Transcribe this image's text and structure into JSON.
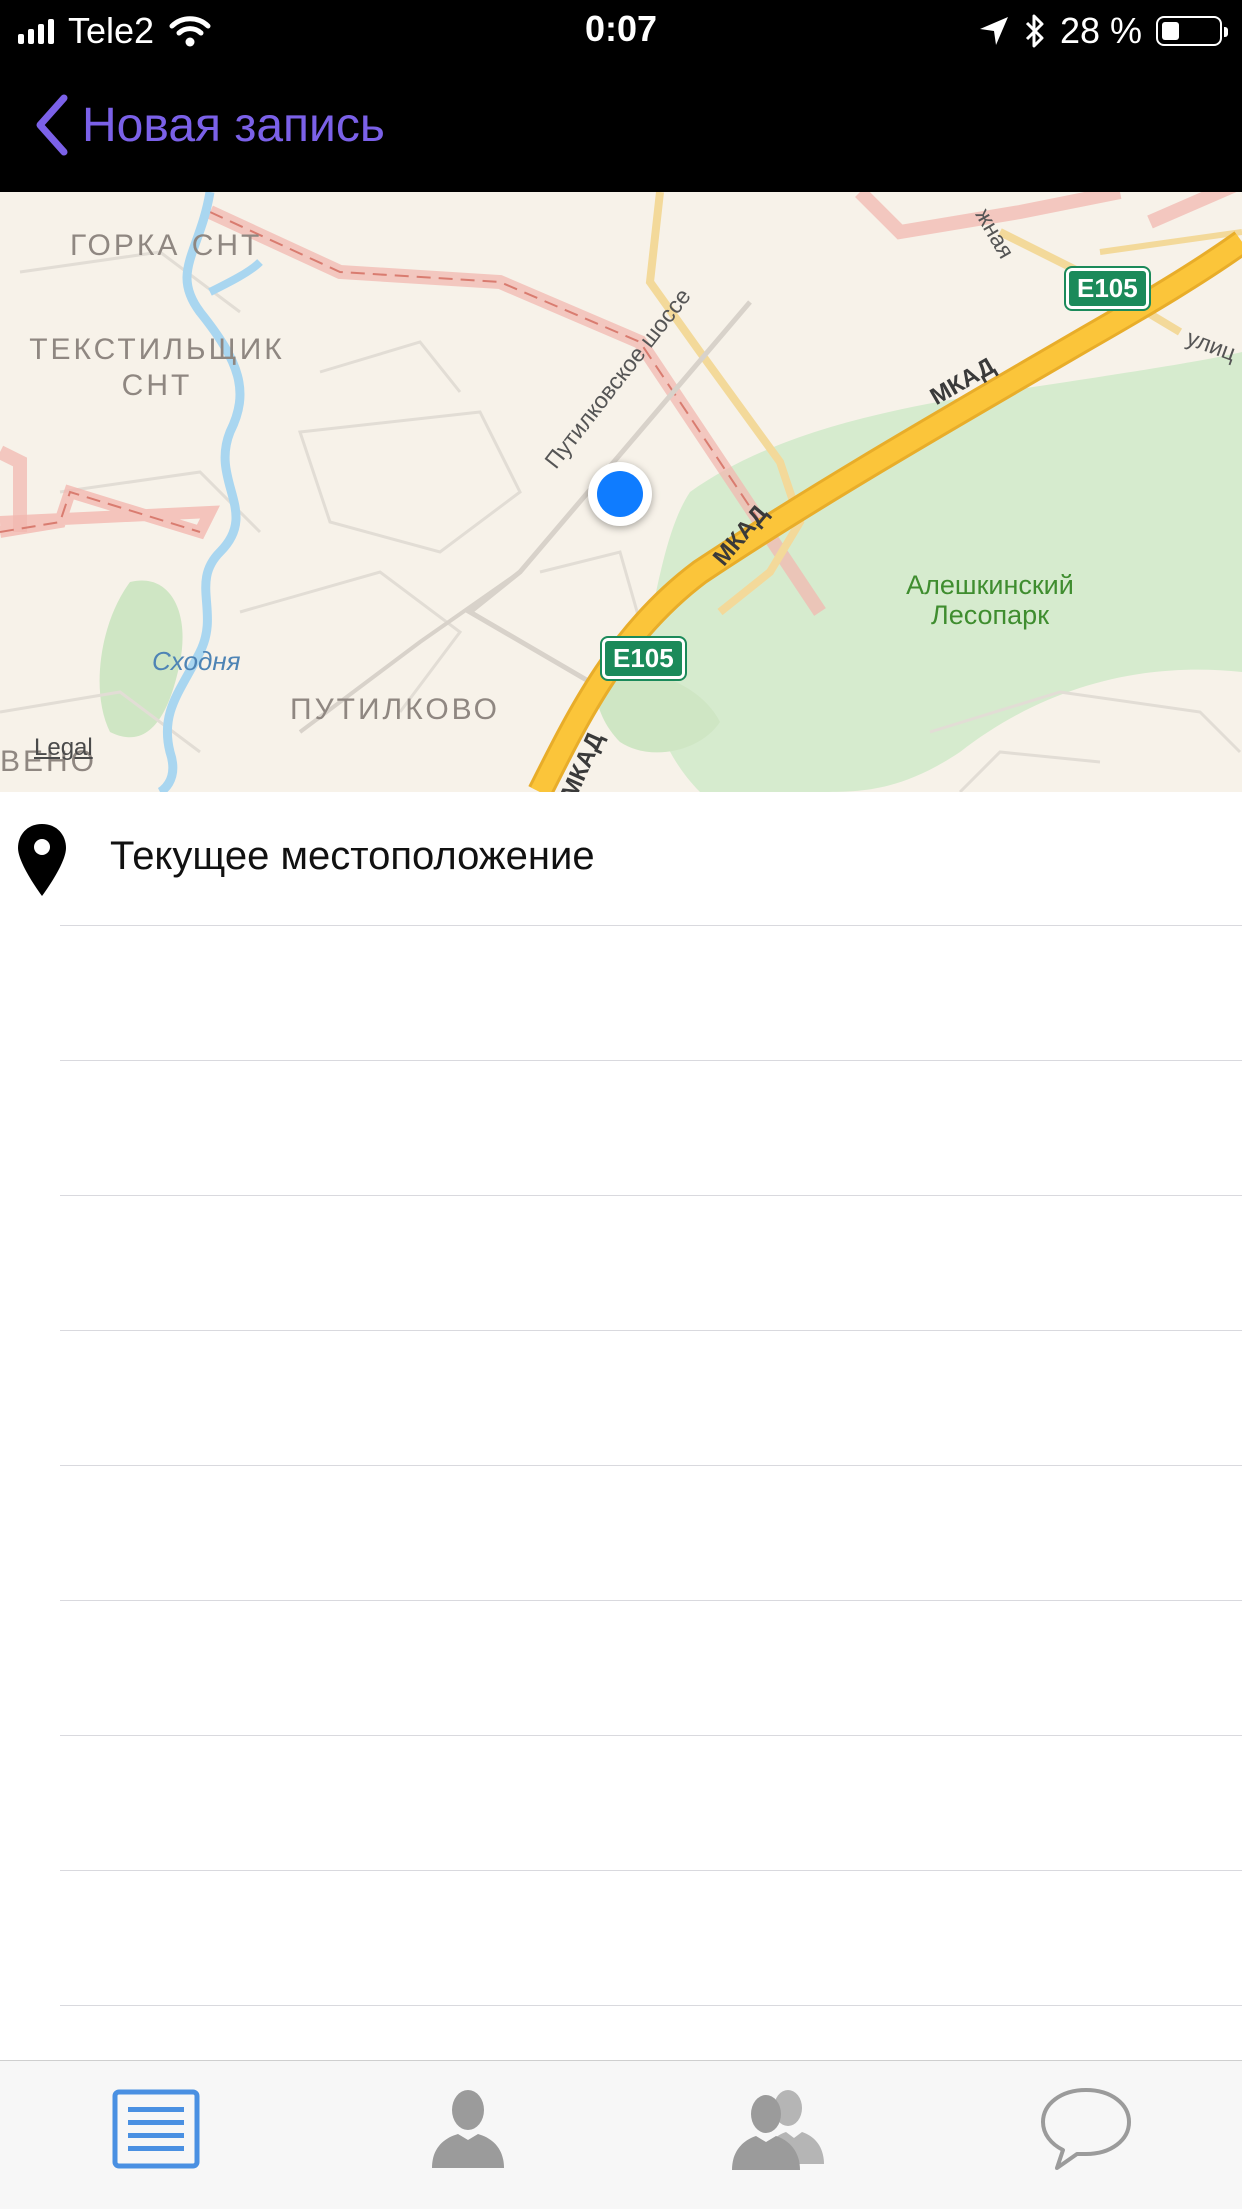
{
  "status_bar": {
    "carrier": "Tele2",
    "time": "0:07",
    "battery_percent": "28 %",
    "battery_level": 0.28,
    "icons": [
      "signal-bars-icon",
      "wifi-icon",
      "location-arrow-icon",
      "bluetooth-icon",
      "battery-icon"
    ]
  },
  "nav": {
    "back_label": "Новая запись"
  },
  "map": {
    "labels": {
      "gorka": "ГОРКА СНТ",
      "tekstilshchik_line1": "ТЕКСТИЛЬЩИК",
      "tekstilshchik_line2": "СНТ",
      "putilkovo": "ПУТИЛКОВО",
      "park_line1": "Алешкинский",
      "park_line2": "Лесопарк",
      "river": "Сходня",
      "road_shosse": "Путилковское шоссе",
      "mkad_1": "МКАД",
      "mkad_2": "МКАД",
      "mkad_3": "МКАД",
      "shield_1": "E105",
      "shield_2": "E105",
      "partial_top": "жная",
      "partial_right": "улиц",
      "partial_left": "ВЕНО"
    },
    "legal": "Legal",
    "colors": {
      "land": "#f7f2e9",
      "park": "#d6ebce",
      "mkad": "#fbc53a",
      "boundary": "#f2b8b0",
      "river": "#a9d6f0",
      "location": "#0f7cff"
    }
  },
  "list": {
    "rows": [
      {
        "label": "Текущее местоположение",
        "icon": "map-pin-icon"
      },
      {
        "label": ""
      },
      {
        "label": ""
      },
      {
        "label": ""
      },
      {
        "label": ""
      },
      {
        "label": ""
      },
      {
        "label": ""
      },
      {
        "label": ""
      },
      {
        "label": ""
      }
    ]
  },
  "tab_bar": {
    "tabs": [
      {
        "name": "entries",
        "icon": "list-icon",
        "active": true
      },
      {
        "name": "contact",
        "icon": "person-icon",
        "active": false
      },
      {
        "name": "group",
        "icon": "people-icon",
        "active": false
      },
      {
        "name": "messages",
        "icon": "chat-bubble-icon",
        "active": false
      }
    ],
    "active_color": "#4a90e2",
    "inactive_color": "#9b9b9b"
  }
}
